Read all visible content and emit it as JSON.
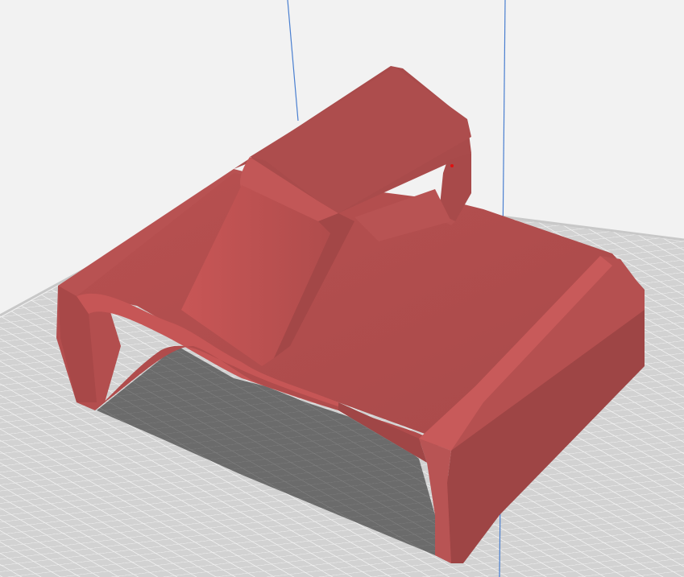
{
  "viewport": {
    "background_color": "#f2f2f2",
    "build_plate_color": "#d2d2d2",
    "grid_line_color": "#f4f4f4",
    "shadow_color": "#6b6b6b",
    "axis_line_color": "#4a7fd0"
  },
  "model": {
    "color": "#c05252",
    "highlight_color": "#d06060",
    "shade_color": "#a84848",
    "dark_color": "#9a4242"
  }
}
